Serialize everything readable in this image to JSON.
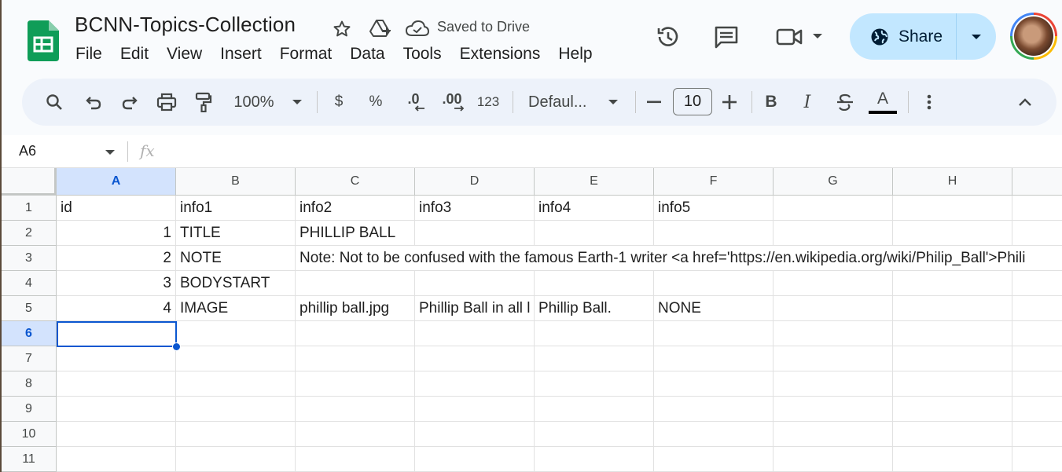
{
  "doc": {
    "title": "BCNN-Topics-Collection",
    "save_status": "Saved to Drive"
  },
  "menu": [
    "File",
    "Edit",
    "View",
    "Insert",
    "Format",
    "Data",
    "Tools",
    "Extensions",
    "Help"
  ],
  "share": {
    "label": "Share"
  },
  "toolbar": {
    "zoom": "100%",
    "currency": "$",
    "percent": "%",
    "dec_decrease": ".0",
    "dec_increase": ".00",
    "number_format": "123",
    "font": "Defaul...",
    "font_size": "10",
    "bold": "B",
    "italic": "I",
    "text_color_letter": "A"
  },
  "formula_bar": {
    "name_box": "A6",
    "fx": "fx",
    "value": ""
  },
  "columns": [
    "A",
    "B",
    "C",
    "D",
    "E",
    "F",
    "G",
    "H"
  ],
  "rows": [
    "1",
    "2",
    "3",
    "4",
    "5",
    "6",
    "7",
    "8",
    "9",
    "10",
    "11"
  ],
  "selected": {
    "column": "A",
    "row": "6"
  },
  "cells": {
    "r1": [
      "id",
      "info1",
      "info2",
      "info3",
      "info4",
      "info5"
    ],
    "r2": [
      "1",
      "TITLE",
      "PHILLIP BALL"
    ],
    "r3": [
      "2",
      "NOTE",
      "Note: Not to be confused with the famous Earth-1 writer <a href='https://en.wikipedia.org/wiki/Philip_Ball'>Phili"
    ],
    "r4": [
      "3",
      "BODYSTART"
    ],
    "r5": [
      "4",
      "IMAGE",
      "phillip ball.jpg",
      "Phillip Ball in all l",
      "Phillip Ball.",
      "NONE"
    ]
  },
  "colors": {
    "accent": "#0b57d0",
    "share_bg": "#c2e7ff",
    "toolbar_bg": "#edf2fa",
    "sheets_green": "#0f9d58"
  }
}
